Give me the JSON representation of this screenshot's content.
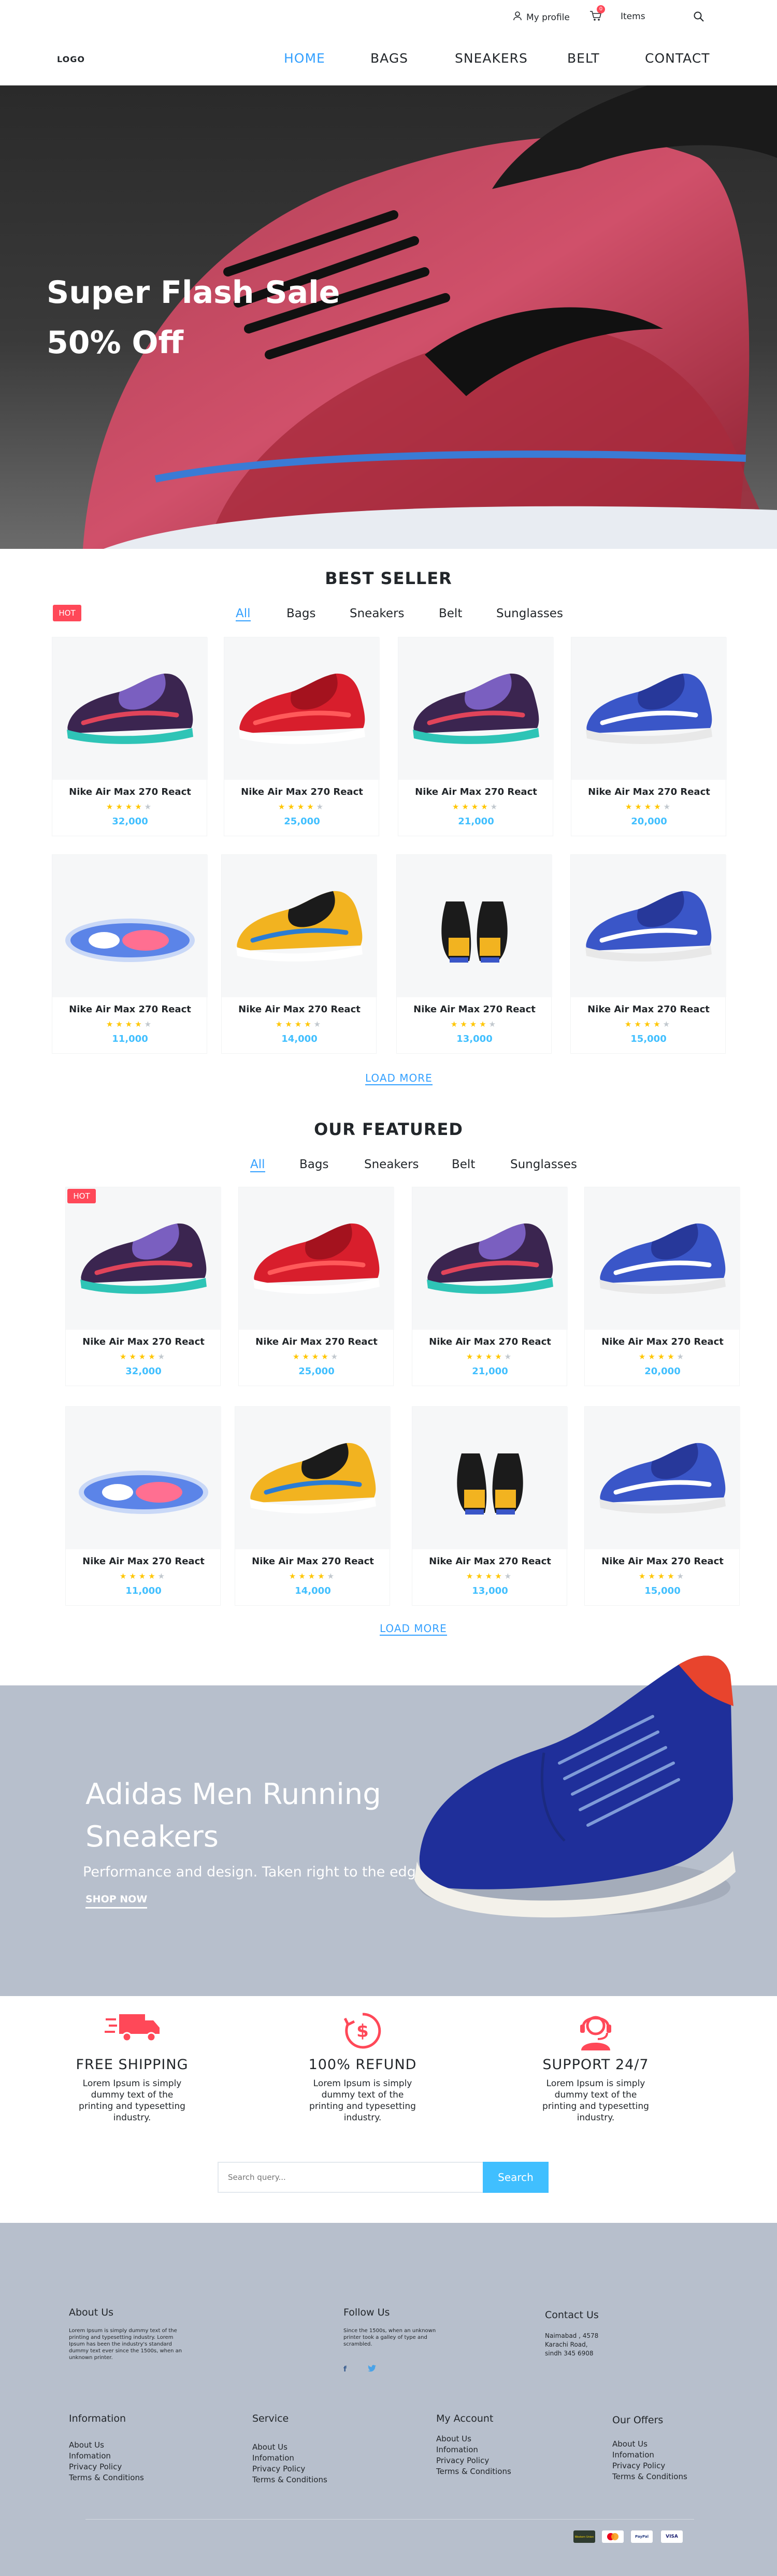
{
  "topbar": {
    "profile": "My profile",
    "cart_count": "0",
    "items": "Items"
  },
  "nav": {
    "logo": "LOGO",
    "items": [
      "HOME",
      "BAGS",
      "SNEAKERS",
      "BELT",
      "CONTACT"
    ]
  },
  "hero": {
    "line1": "Super Flash Sale",
    "line2": "50% Off"
  },
  "best_seller": {
    "title": "BEST SELLER",
    "hot": "HOT",
    "filters": [
      "All",
      "Bags",
      "Sneakers",
      "Belt",
      "Sunglasses"
    ],
    "products": [
      {
        "name": "Nike Air Max 270 React",
        "price": "32,000",
        "rating": 4
      },
      {
        "name": "Nike Air Max 270 React",
        "price": "25,000",
        "rating": 4
      },
      {
        "name": "Nike Air Max 270 React",
        "price": "21,000",
        "rating": 4
      },
      {
        "name": "Nike Air Max 270 React",
        "price": "20,000",
        "rating": 4
      },
      {
        "name": "Nike Air Max 270 React",
        "price": "11,000",
        "rating": 4
      },
      {
        "name": "Nike Air Max 270 React",
        "price": "14,000",
        "rating": 4
      },
      {
        "name": "Nike Air Max 270 React",
        "price": "13,000",
        "rating": 4
      },
      {
        "name": "Nike Air Max 270 React",
        "price": "15,000",
        "rating": 4
      }
    ],
    "load_more": "LOAD MORE"
  },
  "featured": {
    "title": "OUR FEATURED",
    "hot": "HOT",
    "filters": [
      "All",
      "Bags",
      "Sneakers",
      "Belt",
      "Sunglasses"
    ],
    "products": [
      {
        "name": "Nike Air Max 270 React",
        "price": "32,000",
        "rating": 4
      },
      {
        "name": "Nike Air Max 270 React",
        "price": "25,000",
        "rating": 4
      },
      {
        "name": "Nike Air Max 270 React",
        "price": "21,000",
        "rating": 4
      },
      {
        "name": "Nike Air Max 270 React",
        "price": "20,000",
        "rating": 4
      },
      {
        "name": "Nike Air Max 270 React",
        "price": "11,000",
        "rating": 4
      },
      {
        "name": "Nike Air Max 270 React",
        "price": "14,000",
        "rating": 4
      },
      {
        "name": "Nike Air Max 270 React",
        "price": "13,000",
        "rating": 4
      },
      {
        "name": "Nike Air Max 270 React",
        "price": "15,000",
        "rating": 4
      }
    ],
    "load_more": "LOAD MORE"
  },
  "promo": {
    "title": "Adidas Men Running Sneakers",
    "subtitle": "Performance and design. Taken right to the edge.",
    "cta": "SHOP NOW"
  },
  "features": [
    {
      "title": "FREE SHIPPING",
      "desc": "Lorem Ipsum is simply dummy text of the printing and typesetting industry.",
      "icon": "truck-icon"
    },
    {
      "title": "100% REFUND",
      "desc": "Lorem Ipsum is simply dummy text of the printing and typesetting industry.",
      "icon": "refund-icon"
    },
    {
      "title": "SUPPORT 24/7",
      "desc": "Lorem Ipsum is simply dummy text of the printing and typesetting industry.",
      "icon": "support-icon"
    }
  ],
  "search": {
    "placeholder": "Search query...",
    "button": "Search"
  },
  "footer": {
    "about": {
      "title": "About Us",
      "text": "Lorem Ipsum is simply dummy text of the printing and typesetting industry. Lorem Ipsum has been the industry's standard dummy text ever since the 1500s, when an unknown printer."
    },
    "follow": {
      "title": "Follow Us",
      "text": "Since the 1500s, when an unknown printer took a galley of type and scrambled."
    },
    "contact": {
      "title": "Contact Us",
      "lines": [
        "Naimabad , 4578",
        "Karachi Road,",
        "sindh 345 6908"
      ]
    },
    "columns": [
      {
        "title": "Information",
        "items": [
          "About Us",
          "Infomation",
          "Privacy Policy",
          "Terms & Conditions"
        ]
      },
      {
        "title": "Service",
        "items": [
          "About Us",
          "Infomation",
          "Privacy Policy",
          "Terms & Conditions"
        ]
      },
      {
        "title": "My Account",
        "items": [
          "About Us",
          "Infomation",
          "Privacy Policy",
          "Terms & Conditions"
        ]
      },
      {
        "title": "Our Offers",
        "items": [
          "About Us",
          "Infomation",
          "Privacy Policy",
          "Terms & Conditions"
        ]
      }
    ],
    "payments": [
      "Western Union",
      "MasterCard",
      "PayPal",
      "VISA"
    ]
  },
  "colors": {
    "accent": "#33a0ff",
    "hot": "#ff4858",
    "price": "#40bfff",
    "star": "#ffc600",
    "panel": "#b7bfcc"
  }
}
